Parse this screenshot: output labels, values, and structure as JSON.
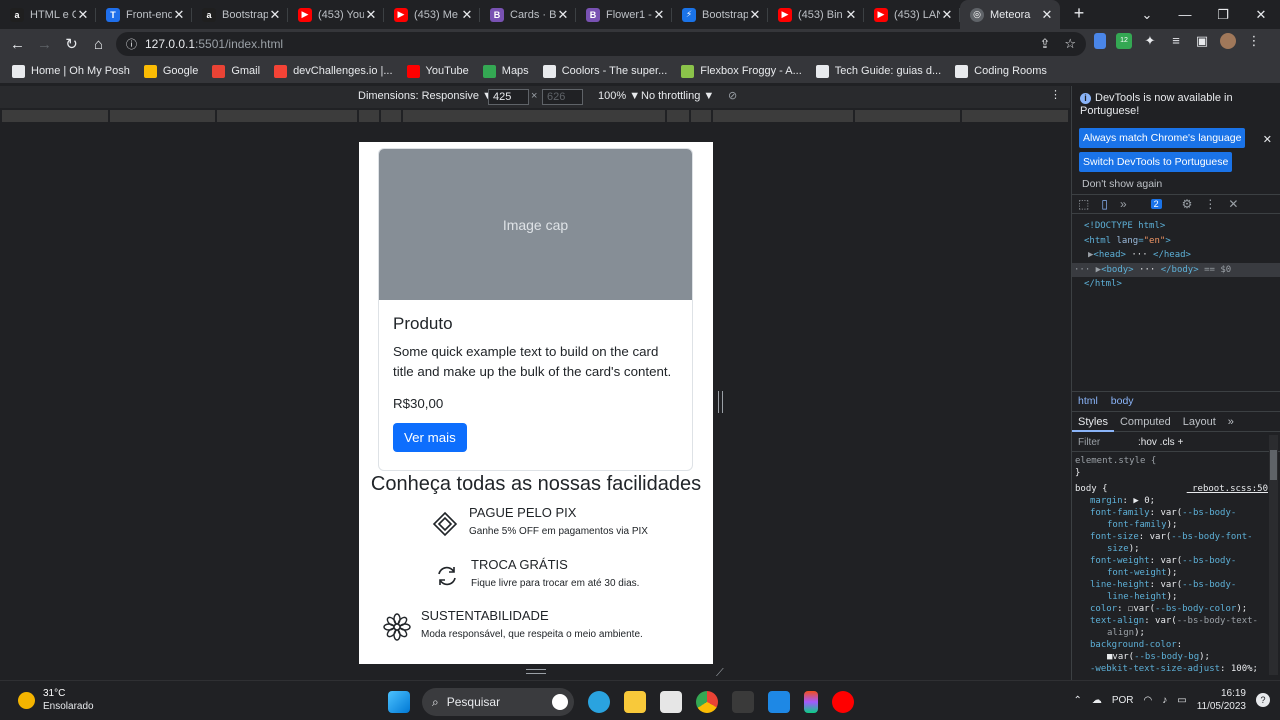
{
  "browser": {
    "tabs": [
      {
        "label": "HTML e C",
        "icon": "a-icon",
        "color": "#1f1f1f"
      },
      {
        "label": "Front-end",
        "icon": "t-icon",
        "color": "#1f6feb"
      },
      {
        "label": "Bootstrap",
        "icon": "a-icon",
        "color": "#1f1f1f"
      },
      {
        "label": "(453) You",
        "icon": "youtube-icon",
        "color": "#ff0000"
      },
      {
        "label": "(453) Me",
        "icon": "youtube-icon",
        "color": "#ff0000"
      },
      {
        "label": "Cards · B",
        "icon": "bootstrap-icon",
        "color": "#7952b3"
      },
      {
        "label": "Flower1 -",
        "icon": "bootstrap-icon",
        "color": "#7952b3"
      },
      {
        "label": "Bootstrap",
        "icon": "bolt-icon",
        "color": "#1a73e8"
      },
      {
        "label": "(453) Bin",
        "icon": "youtube-icon",
        "color": "#ff0000"
      },
      {
        "label": "(453) LAN",
        "icon": "youtube-icon",
        "color": "#ff0000"
      }
    ],
    "active_tab": "Meteora",
    "url_host": "127.0.0.1",
    "url_rest": ":5501/index.html",
    "bookmarks": [
      {
        "label": "Home | Oh My Posh",
        "color": "#e8eaed"
      },
      {
        "label": "Google",
        "color": "#fbbc04"
      },
      {
        "label": "Gmail",
        "color": "#ea4335"
      },
      {
        "label": "devChallenges.io |...",
        "color": "#f44336"
      },
      {
        "label": "YouTube",
        "color": "#ff0000"
      },
      {
        "label": "Maps",
        "color": "#34a853"
      },
      {
        "label": "Coolors - The super...",
        "color": "#e8eaed"
      },
      {
        "label": "Flexbox Froggy - A...",
        "color": "#8bc34a"
      },
      {
        "label": "Tech Guide: guias d...",
        "color": "#e8eaed"
      },
      {
        "label": "Coding Rooms",
        "color": "#e8eaed"
      }
    ]
  },
  "devbar": {
    "dimensions": "Dimensions: Responsive ▼",
    "width": "425",
    "height": "626",
    "times": "×",
    "zoom": "100% ▼",
    "throttle": "No throttling ▼"
  },
  "page": {
    "image_cap": "Image cap",
    "card_title": "Produto",
    "card_text": "Some quick example text to build on the card title and make up the bulk of the card's content.",
    "price": "R$30,00",
    "button": "Ver mais",
    "section_title": "Conheça todas as nossas facilidades",
    "features": [
      {
        "title": "PAGUE PELO PIX",
        "desc": "Ganhe 5% OFF em pagamentos via PIX",
        "icon": "pix-icon"
      },
      {
        "title": "TROCA GRÁTIS",
        "desc": "Fique livre para trocar em até 30 dias.",
        "icon": "exchange-icon"
      },
      {
        "title": "SUSTENTABILIDADE",
        "desc": "Moda responsável, que respeita o meio ambiente.",
        "icon": "flower-icon"
      }
    ]
  },
  "devtools": {
    "notice": "DevTools is now available in Portuguese!",
    "btn_match": "Always match Chrome's language",
    "btn_switch": "Switch DevTools to Portuguese",
    "dont_show": "Don't show again",
    "issues": "2",
    "crumbs": [
      "html",
      "body"
    ],
    "style_tabs": [
      "Styles",
      "Computed",
      "Layout",
      "»"
    ],
    "filter": "Filter",
    "filter_right": ":hov  .cls  +",
    "element_style": "element.style {",
    "body_sel": "body {",
    "source": "_reboot.scss:50"
  },
  "taskbar": {
    "temp": "31°C",
    "weather": "Ensolarado",
    "search": "Pesquisar",
    "lang": "POR",
    "time": "16:19",
    "date": "11/05/2023"
  }
}
